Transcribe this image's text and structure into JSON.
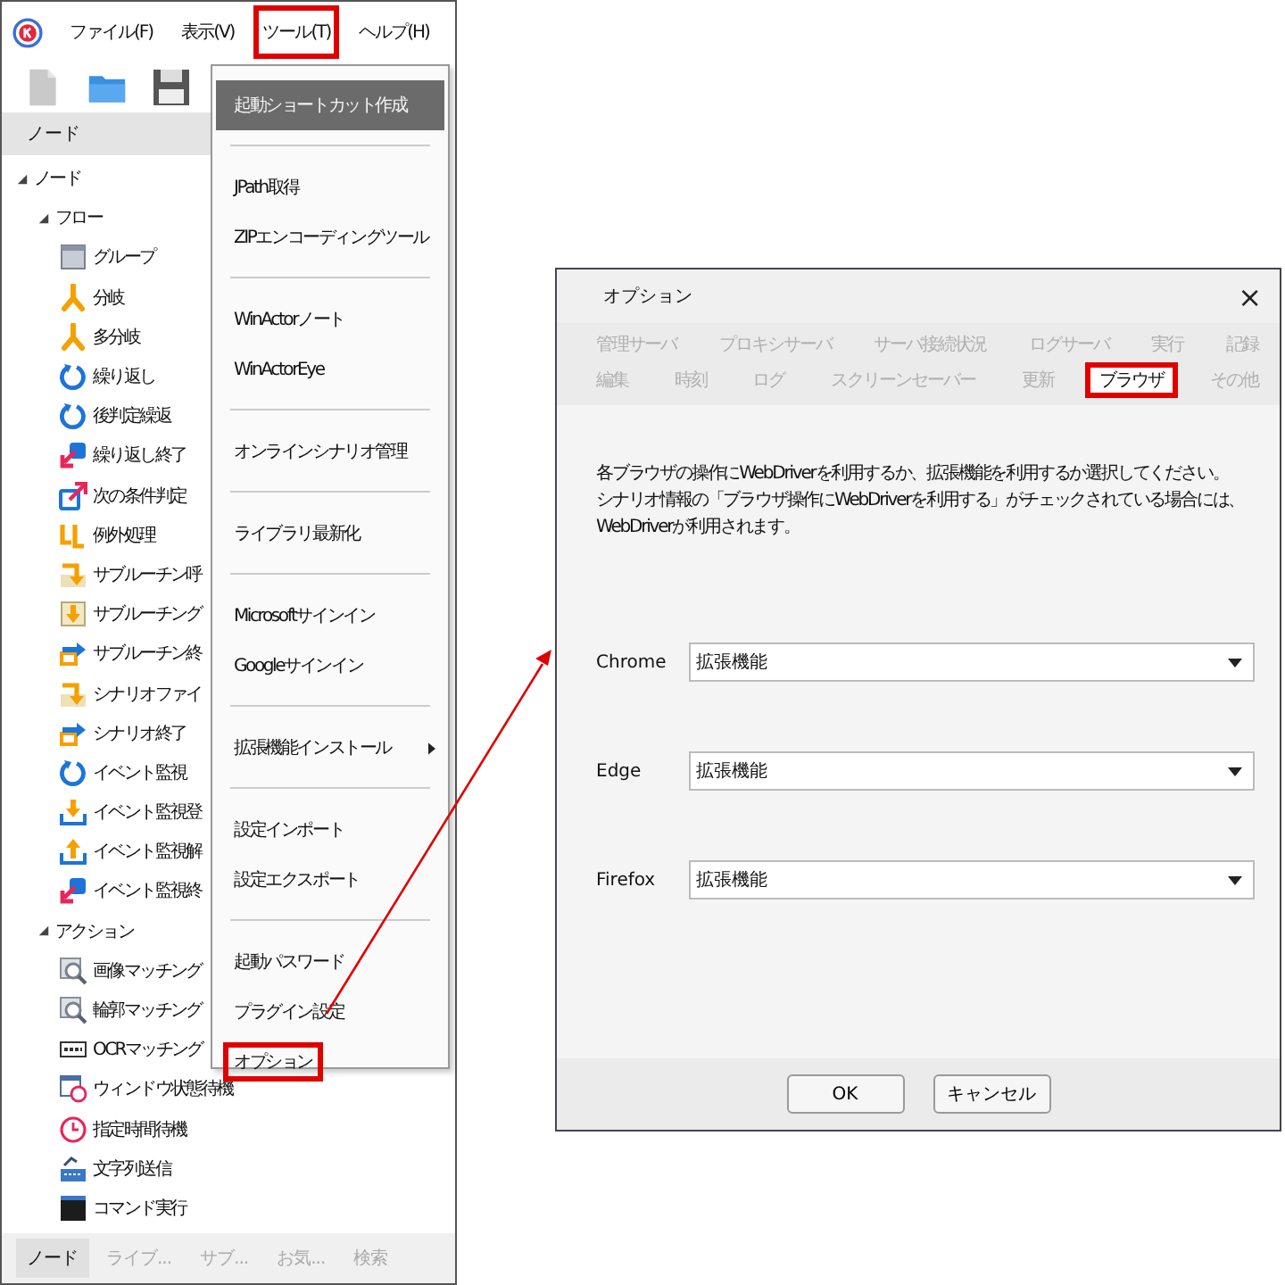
{
  "app": {
    "menu_bar": [
      {
        "label": "ファイル(F)",
        "annotated": false
      },
      {
        "label": "表示(V)",
        "annotated": false
      },
      {
        "label": "ツール(T)",
        "annotated": true
      },
      {
        "label": "ヘルプ(H)",
        "annotated": false
      }
    ],
    "panel_title": "ノード",
    "tree": [
      {
        "label": "ノード",
        "expanded": true,
        "children": [
          {
            "label": "フロー",
            "expanded": true,
            "children": [
              {
                "label": "グループ",
                "kind": "group"
              },
              {
                "label": "分岐",
                "kind": "branch"
              },
              {
                "label": "多分岐",
                "kind": "branch"
              },
              {
                "label": "繰り返し",
                "kind": "loop"
              },
              {
                "label": "後判定繰返",
                "kind": "loop"
              },
              {
                "label": "繰り返し終了",
                "kind": "loop-end"
              },
              {
                "label": "次の条件判定",
                "kind": "condition"
              },
              {
                "label": "例外処理",
                "kind": "exception"
              },
              {
                "label": "サブルーチン呼",
                "kind": "call"
              },
              {
                "label": "サブルーチング",
                "kind": "subgroup"
              },
              {
                "label": "サブルーチン終",
                "kind": "end"
              },
              {
                "label": "シナリオファイ",
                "kind": "call"
              },
              {
                "label": "シナリオ終了",
                "kind": "end"
              },
              {
                "label": "イベント監視",
                "kind": "loop"
              },
              {
                "label": "イベント監視登",
                "kind": "event-register"
              },
              {
                "label": "イベント監視解",
                "kind": "event-release"
              },
              {
                "label": "イベント監視終",
                "kind": "loop-end"
              }
            ]
          },
          {
            "label": "アクション",
            "expanded": true,
            "children": [
              {
                "label": "画像マッチング",
                "kind": "image-match"
              },
              {
                "label": "輪郭マッチング",
                "kind": "image-match"
              },
              {
                "label": "OCRマッチング",
                "kind": "ocr"
              },
              {
                "label": "ウィンドウ状態待機",
                "kind": "window-wait"
              },
              {
                "label": "指定時間待機",
                "kind": "timer"
              },
              {
                "label": "文字列送信",
                "kind": "text-send"
              },
              {
                "label": "コマンド実行",
                "kind": "command"
              }
            ]
          }
        ]
      }
    ],
    "bottom_tabs": [
      {
        "label": "ノード",
        "selected": true
      },
      {
        "label": "ライブ...",
        "selected": false
      },
      {
        "label": "サブ...",
        "selected": false
      },
      {
        "label": "お気...",
        "selected": false
      },
      {
        "label": "検索",
        "selected": false
      }
    ]
  },
  "tools_menu": [
    [
      {
        "label": "起動ショートカット作成",
        "highlighted": true,
        "annotated": false
      }
    ],
    [
      {
        "label": "JPath取得",
        "highlighted": false,
        "annotated": false
      },
      {
        "label": "ZIPエンコーディングツール",
        "highlighted": false,
        "annotated": false
      }
    ],
    [
      {
        "label": "WinActorノート",
        "highlighted": false,
        "annotated": false
      },
      {
        "label": "WinActorEye",
        "highlighted": false,
        "annotated": false
      }
    ],
    [
      {
        "label": "オンラインシナリオ管理",
        "highlighted": false,
        "annotated": false
      }
    ],
    [
      {
        "label": "ライブラリ最新化",
        "highlighted": false,
        "annotated": false
      }
    ],
    [
      {
        "label": "Microsoftサインイン",
        "highlighted": false,
        "annotated": false
      },
      {
        "label": "Googleサインイン",
        "highlighted": false,
        "annotated": false
      }
    ],
    [
      {
        "label": "拡張機能インストール",
        "highlighted": false,
        "annotated": false,
        "submenu": true
      }
    ],
    [
      {
        "label": "設定インポート",
        "highlighted": false,
        "annotated": false
      },
      {
        "label": "設定エクスポート",
        "highlighted": false,
        "annotated": false
      }
    ],
    [
      {
        "label": "起動パスワード",
        "highlighted": false,
        "annotated": false
      },
      {
        "label": "プラグイン設定",
        "highlighted": false,
        "annotated": false
      },
      {
        "label": "オプション",
        "highlighted": false,
        "annotated": true
      }
    ]
  ],
  "dialog": {
    "title": "オプション",
    "close": "×",
    "tab_rows": [
      [
        {
          "label": "管理サーバ",
          "selected": false,
          "annotated": false
        },
        {
          "label": "プロキシサーバ",
          "selected": false,
          "annotated": false
        },
        {
          "label": "サーバ接続状況",
          "selected": false,
          "annotated": false
        },
        {
          "label": "ログサーバ",
          "selected": false,
          "annotated": false
        },
        {
          "label": "実行",
          "selected": false,
          "annotated": false
        },
        {
          "label": "記録",
          "selected": false,
          "annotated": false
        }
      ],
      [
        {
          "label": "編集",
          "selected": false,
          "annotated": false
        },
        {
          "label": "時刻",
          "selected": false,
          "annotated": false
        },
        {
          "label": "ログ",
          "selected": false,
          "annotated": false
        },
        {
          "label": "スクリーンセーバー",
          "selected": false,
          "annotated": false
        },
        {
          "label": "更新",
          "selected": false,
          "annotated": false
        },
        {
          "label": "ブラウザ",
          "selected": true,
          "annotated": true
        },
        {
          "label": "その他",
          "selected": false,
          "annotated": false
        }
      ]
    ],
    "description_lines": [
      "各ブラウザの操作にWebDriverを利用するか、拡張機能を利用するか選択してください。",
      "シナリオ情報の「ブラウザ操作にWebDriverを利用する」がチェックされている場合には、",
      "WebDriverが利用されます。"
    ],
    "fields": [
      {
        "label": "Chrome",
        "value": "拡張機能"
      },
      {
        "label": "Edge",
        "value": "拡張機能"
      },
      {
        "label": "Firefox",
        "value": "拡張機能"
      }
    ],
    "buttons": [
      "OK",
      "キャンセル"
    ]
  }
}
